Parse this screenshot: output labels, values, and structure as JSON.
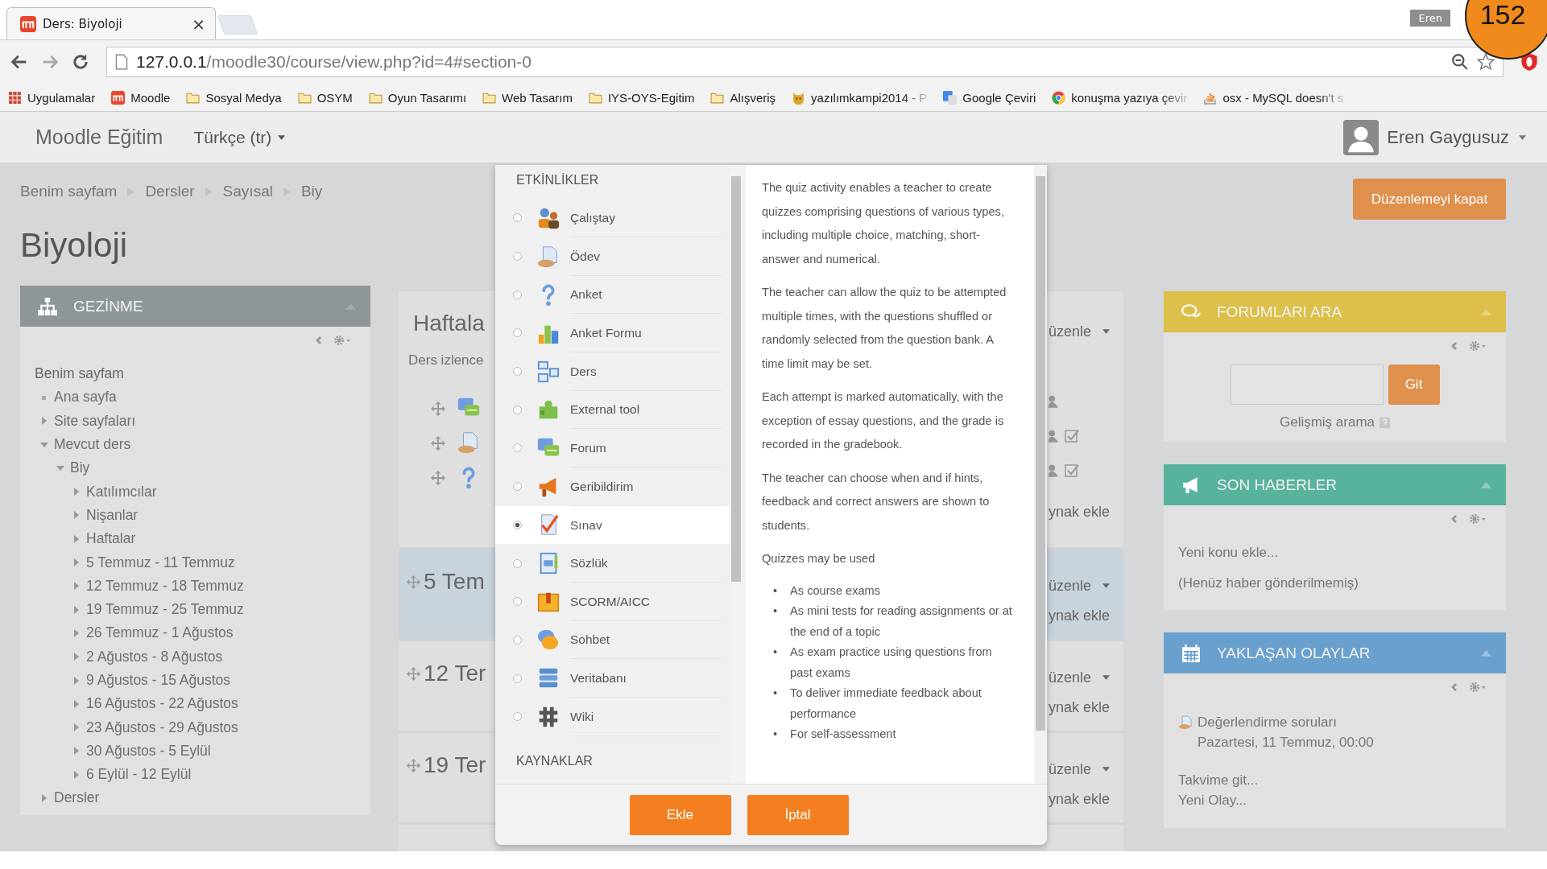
{
  "browser": {
    "tab_title": "Ders: Biyoloji",
    "tab_close": "×",
    "profile": "Eren",
    "corner_badge": "152",
    "url_host": "127.0.0.1",
    "url_path": "/moodle30/course/view.php?id=4#section-0",
    "bookmarks": [
      {
        "kind": "apps",
        "label": "Uygulamalar",
        "faded": false
      },
      {
        "kind": "moodle",
        "label": "Moodle",
        "faded": false
      },
      {
        "kind": "folder",
        "label": "Sosyal Medya",
        "faded": false
      },
      {
        "kind": "folder",
        "label": "OSYM",
        "faded": false
      },
      {
        "kind": "folder",
        "label": "Oyun Tasarımı",
        "faded": false
      },
      {
        "kind": "folder",
        "label": "Web Tasarım",
        "faded": false
      },
      {
        "kind": "folder",
        "label": "IYS-OYS-Egitim",
        "faded": false
      },
      {
        "kind": "folder",
        "label": "Alışveriş",
        "faded": false
      },
      {
        "kind": "mascot",
        "label": "yazılımkampi2014 - P",
        "faded": true
      },
      {
        "kind": "translate",
        "label": "Google Çeviri",
        "faded": false
      },
      {
        "kind": "globe",
        "label": "konuşma yazıya çevir",
        "faded": true
      },
      {
        "kind": "stack",
        "label": "osx - MySQL doesn't s",
        "faded": true
      }
    ]
  },
  "navbar": {
    "brand": "Moodle Eğitim",
    "language": "Türkçe (tr)",
    "user": "Eren Gaygusuz"
  },
  "breadcrumb": [
    "Benim sayfam",
    "Dersler",
    "Sayısal",
    "Biy"
  ],
  "page_title": "Biyoloji",
  "edit_button": "Düzenlemeyi kapat",
  "navigation_block": {
    "title": "GEZİNME",
    "tree": [
      {
        "label": "Benim sayfam",
        "kind": "heading",
        "children": [
          {
            "label": "Ana sayfa",
            "kind": "leaf"
          },
          {
            "label": "Site sayfaları",
            "kind": "branch",
            "expanded": false
          },
          {
            "label": "Mevcut ders",
            "kind": "branch",
            "expanded": true,
            "children": [
              {
                "label": "Biy",
                "kind": "branch",
                "expanded": true,
                "children": [
                  {
                    "label": "Katılımcılar",
                    "kind": "branch",
                    "expanded": false
                  },
                  {
                    "label": "Nişanlar",
                    "kind": "branch",
                    "expanded": false
                  },
                  {
                    "label": "Haftalar",
                    "kind": "branch",
                    "expanded": false
                  },
                  {
                    "label": "5 Temmuz - 11 Temmuz",
                    "kind": "branch",
                    "expanded": false
                  },
                  {
                    "label": "12 Temmuz - 18 Temmuz",
                    "kind": "branch",
                    "expanded": false
                  },
                  {
                    "label": "19 Temmuz - 25 Temmuz",
                    "kind": "branch",
                    "expanded": false
                  },
                  {
                    "label": "26 Temmuz - 1 Ağustos",
                    "kind": "branch",
                    "expanded": false
                  },
                  {
                    "label": "2 Ağustos - 8 Ağustos",
                    "kind": "branch",
                    "expanded": false
                  },
                  {
                    "label": "9 Ağustos - 15 Ağustos",
                    "kind": "branch",
                    "expanded": false
                  },
                  {
                    "label": "16 Ağustos - 22 Ağustos",
                    "kind": "branch",
                    "expanded": false
                  },
                  {
                    "label": "23 Ağustos - 29 Ağustos",
                    "kind": "branch",
                    "expanded": false
                  },
                  {
                    "label": "30 Ağustos - 5 Eylül",
                    "kind": "branch",
                    "expanded": false
                  },
                  {
                    "label": "6 Eylül - 12 Eylül",
                    "kind": "branch",
                    "expanded": false
                  }
                ]
              }
            ]
          },
          {
            "label": "Dersler",
            "kind": "branch",
            "expanded": false
          }
        ]
      }
    ]
  },
  "sections": [
    {
      "title": "Haftala",
      "summary": "Ders izlence",
      "highlighted": false,
      "edit": "üzenle",
      "add": "ynak ekle",
      "activities": [
        {
          "kind": "forum",
          "checkbox": false
        },
        {
          "kind": "assign",
          "checkbox": true
        },
        {
          "kind": "choice",
          "checkbox": true
        }
      ]
    },
    {
      "title": "5 Tem",
      "highlighted": true,
      "edit": "üzenle",
      "add": "ynak ekle"
    },
    {
      "title": "12 Ter",
      "highlighted": false,
      "edit": "üzenle",
      "add": "ynak ekle"
    },
    {
      "title": "19 Ter",
      "highlighted": false,
      "edit": "üzenle",
      "add": "ynak ekle"
    }
  ],
  "chooser": {
    "heading": "ETKİNLİKLER",
    "items": [
      {
        "label": "Çalıştay",
        "kind": "workshop",
        "selected": false
      },
      {
        "label": "Ödev",
        "kind": "assign",
        "selected": false
      },
      {
        "label": "Anket",
        "kind": "choice",
        "selected": false
      },
      {
        "label": "Anket Formu",
        "kind": "survey",
        "selected": false
      },
      {
        "label": "Ders",
        "kind": "lesson",
        "selected": false
      },
      {
        "label": "External tool",
        "kind": "lti",
        "selected": false
      },
      {
        "label": "Forum",
        "kind": "forum",
        "selected": false
      },
      {
        "label": "Geribildirim",
        "kind": "feedback",
        "selected": false
      },
      {
        "label": "Sınav",
        "kind": "quiz",
        "selected": true
      },
      {
        "label": "Sözlük",
        "kind": "glossary",
        "selected": false
      },
      {
        "label": "SCORM/AICC",
        "kind": "scorm",
        "selected": false
      },
      {
        "label": "Sohbet",
        "kind": "chat",
        "selected": false
      },
      {
        "label": "Veritabanı",
        "kind": "data",
        "selected": false
      },
      {
        "label": "Wiki",
        "kind": "wiki",
        "selected": false
      }
    ],
    "resources_heading": "KAYNAKLAR",
    "paragraphs": [
      "The quiz activity enables a teacher to create quizzes comprising questions of various types, including multiple choice, matching, short-answer and numerical.",
      "The teacher can allow the quiz to be attempted multiple times, with the questions shuffled or randomly selected from the question bank. A time limit may be set.",
      "Each attempt is marked automatically, with the exception of essay questions, and the grade is recorded in the gradebook.",
      "The teacher can choose when and if hints, feedback and correct answers are shown to students.",
      "Quizzes may be used"
    ],
    "bullet_mark": "•",
    "bullets": [
      "As course exams",
      "As mini tests for reading assignments or at the end of a topic",
      "As exam practice using questions from past exams",
      "To deliver immediate feedback about performance",
      "For self-assessment"
    ],
    "buttons": [
      "Ekle",
      "İptal"
    ]
  },
  "blocks": [
    {
      "kind": "search",
      "title": "FORUMLARI ARA",
      "color": "#dcc04a",
      "button": "Git",
      "link": "Gelişmiş arama"
    },
    {
      "kind": "news",
      "title": "SON HABERLER",
      "color": "#58b39c",
      "lines": [
        "Yeni konu ekle...",
        "(Henüz haber gönderilmemiş)"
      ]
    },
    {
      "kind": "events",
      "title": "YAKLAŞAN OLAYLAR",
      "color": "#69a0cd",
      "event_title": "Değerlendirme soruları",
      "event_date": "Pazartesi, 11 Temmuz, 00:00",
      "links": [
        "Takvime git...",
        "Yeni Olay..."
      ]
    }
  ]
}
